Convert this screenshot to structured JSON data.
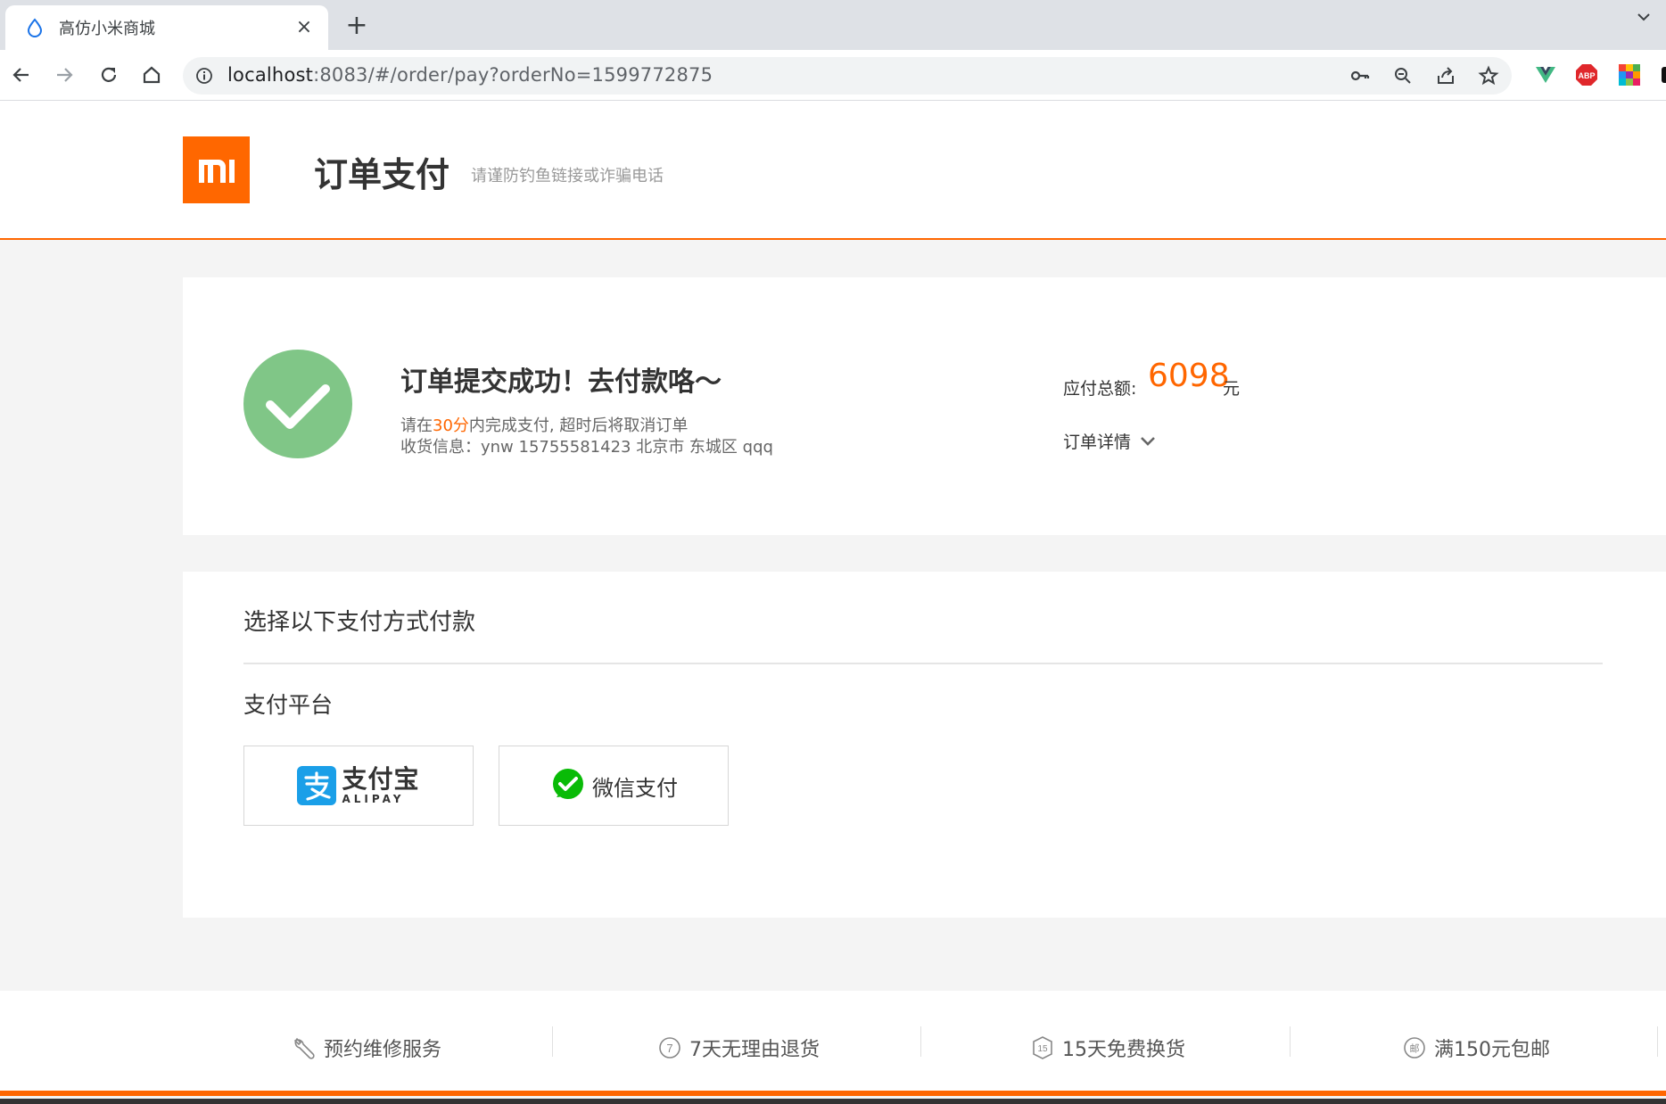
{
  "browser": {
    "tab_title": "高仿小米商城",
    "tab_close": "×",
    "new_tab": "+",
    "url_host": "localhost",
    "url_rest": ":8083/#/order/pay?orderNo=1599772875"
  },
  "header": {
    "logo_text": "mi",
    "title": "订单支付",
    "subtitle": "请谨防钓鱼链接或诈骗电话"
  },
  "order": {
    "title": "订单提交成功！去付款咯～",
    "line1_prefix": "请在",
    "line1_highlight": "30分",
    "line1_suffix": "内完成支付, 超时后将取消订单",
    "line2": "收货信息：ynw 15755581423 北京市 东城区 qqq",
    "total_label": "应付总额:",
    "total_value": "6098",
    "total_unit": "元",
    "detail_label": "订单详情"
  },
  "payment": {
    "heading": "选择以下支付方式付款",
    "platform_label": "支付平台",
    "alipay_cn": "支付宝",
    "alipay_en": "ALIPAY",
    "wechat_label": "微信支付"
  },
  "footer": {
    "services": [
      "预约维修服务",
      "7天无理由退货",
      "15天免费换货",
      "满150元包邮"
    ]
  },
  "colors": {
    "accent": "#ff6600",
    "success": "#80c687",
    "alipay_blue": "#1a9fe8",
    "wechat_green": "#09bb07"
  }
}
